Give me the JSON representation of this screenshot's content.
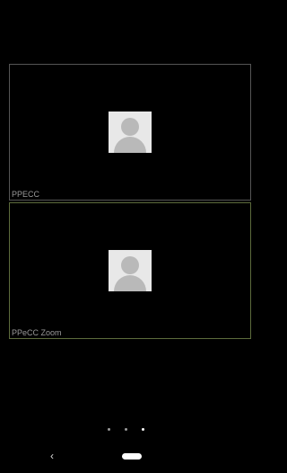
{
  "participants": [
    {
      "name": "PPECC"
    },
    {
      "name": "PPeCC Zoom"
    }
  ],
  "pager": {
    "pages": 3,
    "current": 3
  },
  "navbar": {
    "back_icon": "chevron-left-icon",
    "home_icon": "home-pill-icon"
  }
}
